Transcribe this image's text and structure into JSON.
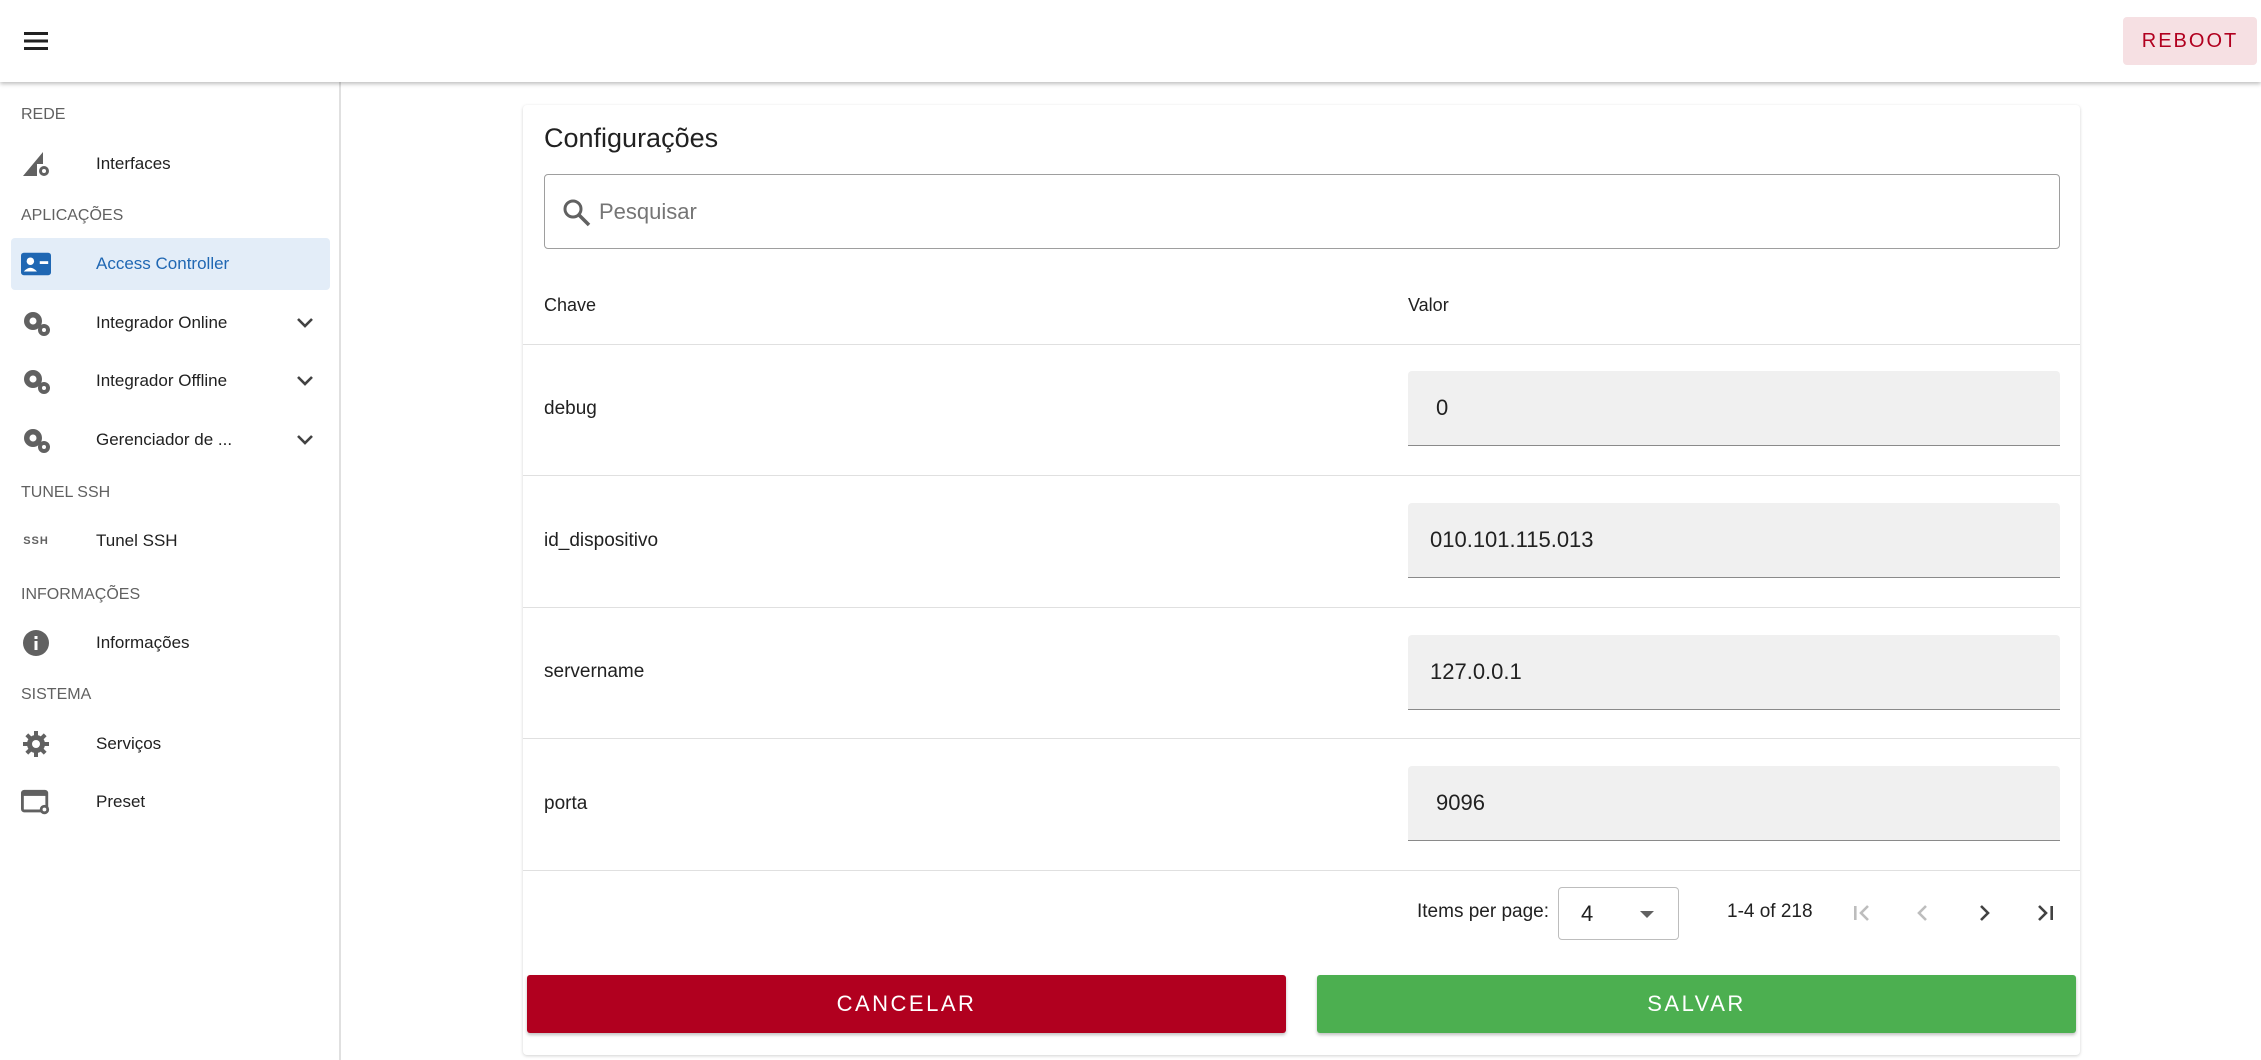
{
  "header": {
    "reboot_label": "REBOOT",
    "menu_icon": "hamburger-menu-icon"
  },
  "sidebar": {
    "sections": {
      "rede": "REDE",
      "aplicacoes": "APLICAÇÕES",
      "tunel": "TUNEL SSH",
      "informacoes": "INFORMAÇÕES",
      "sistema": "SISTEMA"
    },
    "items": [
      {
        "label": "Interfaces",
        "icon": "network-settings-icon"
      },
      {
        "label": "Access Controller",
        "icon": "badge-card-icon",
        "active": true
      },
      {
        "label": "Integrador Online",
        "icon": "gears-icon",
        "expandable": true
      },
      {
        "label": "Integrador Offline",
        "icon": "gears-icon",
        "expandable": true
      },
      {
        "label": "Gerenciador de ...",
        "icon": "gears-icon",
        "expandable": true
      },
      {
        "label": "Tunel SSH",
        "icon": "ssh-icon"
      },
      {
        "label": "Informações",
        "icon": "info-icon"
      },
      {
        "label": "Serviços",
        "icon": "gear-icon"
      },
      {
        "label": "Preset",
        "icon": "window-settings-icon"
      }
    ],
    "ssh_glyph": "SSH"
  },
  "main": {
    "title": "Configurações",
    "search": {
      "placeholder": "Pesquisar",
      "value": ""
    },
    "columns": {
      "key": "Chave",
      "value": "Valor"
    },
    "rows": [
      {
        "key": "debug",
        "value": "0"
      },
      {
        "key": "id_dispositivo",
        "value": "010.101.115.013"
      },
      {
        "key": "servername",
        "value": "127.0.0.1"
      },
      {
        "key": "porta",
        "value": "9096"
      }
    ],
    "pagination": {
      "items_per_page_label": "Items per page:",
      "items_per_page": "4",
      "range": "1-4 of 218"
    },
    "buttons": {
      "cancel": "CANCELAR",
      "save": "SALVAR"
    }
  },
  "colors": {
    "accent": "#1f67b3",
    "danger": "#b1001f",
    "success": "#4caf50",
    "active_bg": "#e3edf8"
  }
}
